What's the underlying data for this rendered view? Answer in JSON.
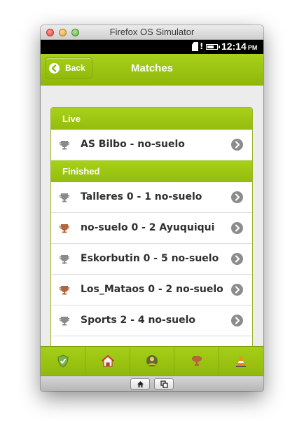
{
  "window": {
    "title": "Firefox OS Simulator"
  },
  "status": {
    "time": "12:14",
    "ampm": "PM",
    "battery_level": 0.7
  },
  "header": {
    "back_label": "Back",
    "title": "Matches"
  },
  "sections": [
    {
      "title": "Live",
      "items": [
        {
          "label": "AS Bilbo - no-suelo",
          "trophy": "silver"
        }
      ]
    },
    {
      "title": "Finished",
      "items": [
        {
          "label": "Talleres 0 - 1 no-suelo",
          "trophy": "silver"
        },
        {
          "label": "no-suelo 0 - 2 Ayuquiqui",
          "trophy": "bronze"
        },
        {
          "label": "Eskorbutin 0 - 5 no-suelo",
          "trophy": "silver"
        },
        {
          "label": "Los_Mataos 0 - 2 no-suelo",
          "trophy": "bronze"
        },
        {
          "label": "Sports 2 - 4 no-suelo",
          "trophy": "silver"
        }
      ]
    }
  ],
  "tabbar": {
    "tabs": [
      {
        "icon": "shield-icon"
      },
      {
        "icon": "home-icon"
      },
      {
        "icon": "player-icon"
      },
      {
        "icon": "trophy-icon"
      },
      {
        "icon": "cone-icon"
      }
    ]
  },
  "simulator": {
    "buttons": [
      {
        "icon": "home-icon"
      },
      {
        "icon": "windows-icon"
      }
    ]
  },
  "colors": {
    "accent": "#99c213",
    "silver_trophy": "#8a8a8a",
    "bronze_trophy": "#b5653a",
    "arrow": "#8c8c8c"
  }
}
